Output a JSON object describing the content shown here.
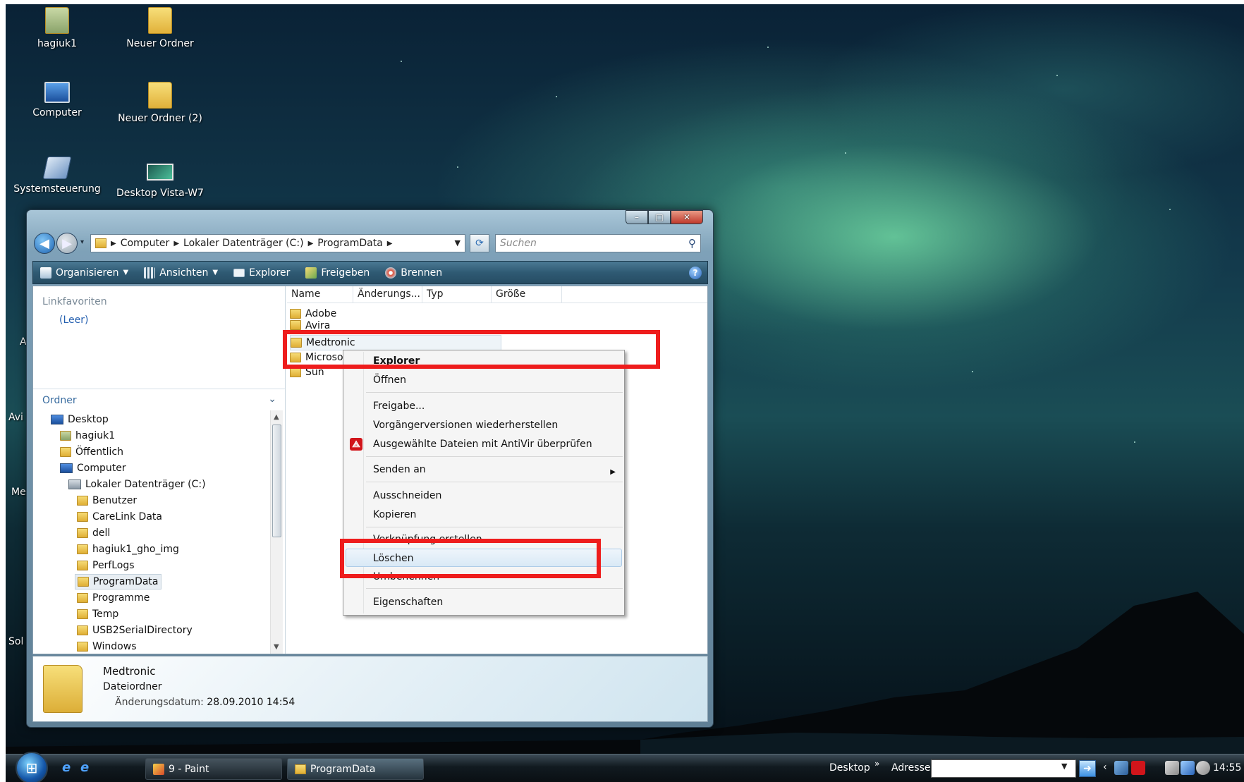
{
  "desktop": {
    "icons": [
      {
        "label": "hagiuk1",
        "icon": "user-folder-icon"
      },
      {
        "label": "Neuer Ordner",
        "icon": "folder-icon"
      },
      {
        "label": "Computer",
        "icon": "computer-icon"
      },
      {
        "label": "Neuer Ordner (2)",
        "icon": "folder-icon"
      },
      {
        "label": "Systemsteuerung",
        "icon": "control-panel-icon"
      },
      {
        "label": "Desktop Vista-W7",
        "icon": "image-file-icon"
      }
    ],
    "partial_labels": [
      "A",
      "Avi",
      "Me",
      "Sol"
    ]
  },
  "window": {
    "buttons": {
      "minimize": "–",
      "maximize": "□",
      "close": "✕"
    },
    "nav": {
      "back": "◀",
      "forward": "▶",
      "drop": "▾"
    },
    "breadcrumb": [
      "Computer",
      "Lokaler Datenträger (C:)",
      "ProgramData"
    ],
    "search_placeholder": "Suchen",
    "toolbar": {
      "organize": "Organisieren",
      "views": "Ansichten",
      "explorer": "Explorer",
      "share": "Freigeben",
      "burn": "Brennen",
      "help": "?"
    },
    "nav_pane": {
      "favorites_header": "Linkfavoriten",
      "favorites_empty": "(Leer)",
      "folders_header": "Ordner",
      "tree": [
        {
          "label": "Desktop",
          "level": 0,
          "icon": "desktop-icon"
        },
        {
          "label": "hagiuk1",
          "level": 1,
          "icon": "user-folder-icon"
        },
        {
          "label": "Öffentlich",
          "level": 1,
          "icon": "folder-icon"
        },
        {
          "label": "Computer",
          "level": 1,
          "icon": "computer-icon"
        },
        {
          "label": "Lokaler Datenträger (C:)",
          "level": 2,
          "icon": "drive-icon"
        },
        {
          "label": "Benutzer",
          "level": 3,
          "icon": "folder-icon"
        },
        {
          "label": "CareLink Data",
          "level": 3,
          "icon": "folder-icon"
        },
        {
          "label": "dell",
          "level": 3,
          "icon": "folder-icon"
        },
        {
          "label": "hagiuk1_gho_img",
          "level": 3,
          "icon": "folder-icon"
        },
        {
          "label": "PerfLogs",
          "level": 3,
          "icon": "folder-icon"
        },
        {
          "label": "ProgramData",
          "level": 3,
          "icon": "folder-icon",
          "selected": true
        },
        {
          "label": "Programme",
          "level": 3,
          "icon": "folder-icon"
        },
        {
          "label": "Temp",
          "level": 3,
          "icon": "folder-icon"
        },
        {
          "label": "USB2SerialDirectory",
          "level": 3,
          "icon": "folder-icon"
        },
        {
          "label": "Windows",
          "level": 3,
          "icon": "folder-icon"
        }
      ]
    },
    "columns": [
      "Name",
      "Änderungs...",
      "Typ",
      "Größe"
    ],
    "files": [
      {
        "name": "Adobe"
      },
      {
        "name": "Avira"
      },
      {
        "name": "Medtronic",
        "highlighted": true
      },
      {
        "name": "Microso"
      },
      {
        "name": "Sun"
      }
    ],
    "details": {
      "name": "Medtronic",
      "type": "Dateiordner",
      "date_label": "Änderungsdatum:",
      "date_value": "28.09.2010 14:54"
    }
  },
  "context_menu": {
    "items": [
      {
        "label": "Explorer",
        "bold": true
      },
      {
        "label": "Öffnen"
      },
      {
        "label": "Freigabe..."
      },
      {
        "label": "Vorgängerversionen wiederherstellen"
      },
      {
        "label": "Ausgewählte Dateien mit AntiVir überprüfen",
        "icon": "antivir-icon"
      },
      {
        "label": "Senden an",
        "submenu": true
      },
      {
        "label": "Ausschneiden"
      },
      {
        "label": "Kopieren"
      },
      {
        "label": "Verknüpfung erstellen"
      },
      {
        "label": "Löschen",
        "highlighted": true
      },
      {
        "label": "Umbenennen"
      },
      {
        "label": "Eigenschaften"
      }
    ],
    "submenu_arrow": "▶"
  },
  "taskbar": {
    "tasks": [
      {
        "label": "9 - Paint",
        "icon": "paint-icon"
      },
      {
        "label": "ProgramData",
        "icon": "folder-icon",
        "active": true
      }
    ],
    "desktop_label": "Desktop",
    "chevron": "»",
    "address_label": "Adresse",
    "clock": "14:55"
  },
  "colors": {
    "annotation_red": "#ee1c1c",
    "toolbar_blue": "#2f5a73",
    "link_blue": "#2560b0"
  }
}
